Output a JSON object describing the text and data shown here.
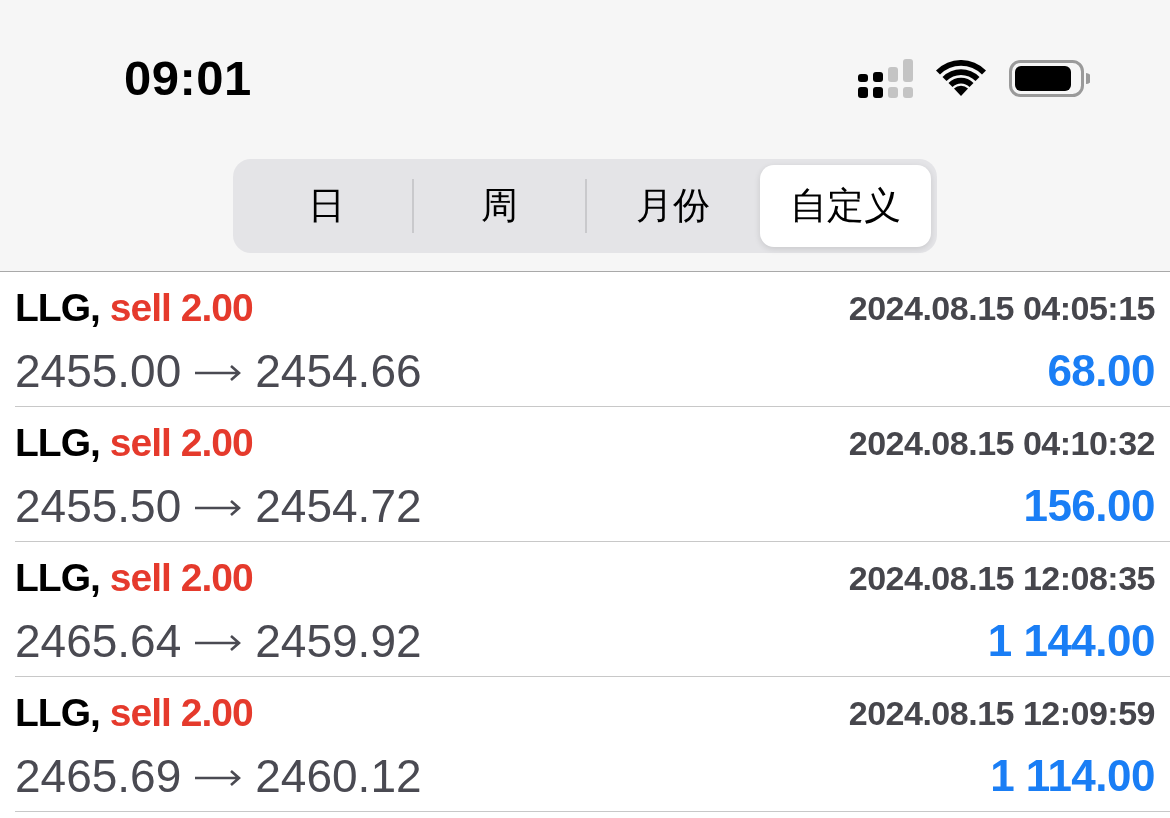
{
  "status_bar": {
    "time": "09:01"
  },
  "period_tabs": [
    {
      "label": "日",
      "selected": false
    },
    {
      "label": "周",
      "selected": false
    },
    {
      "label": "月份",
      "selected": false
    },
    {
      "label": "自定义",
      "selected": true
    }
  ],
  "trades": [
    {
      "symbol": "LLG,",
      "order": "sell 2.00",
      "time": "2024.08.15 04:05:15",
      "open_price": "2455.00",
      "close_price": "2454.66",
      "profit": "68.00"
    },
    {
      "symbol": "LLG,",
      "order": "sell 2.00",
      "time": "2024.08.15 04:10:32",
      "open_price": "2455.50",
      "close_price": "2454.72",
      "profit": "156.00"
    },
    {
      "symbol": "LLG,",
      "order": "sell 2.00",
      "time": "2024.08.15 12:08:35",
      "open_price": "2465.64",
      "close_price": "2459.92",
      "profit": "1 144.00"
    },
    {
      "symbol": "LLG,",
      "order": "sell 2.00",
      "time": "2024.08.15 12:09:59",
      "open_price": "2465.69",
      "close_price": "2460.12",
      "profit": "1 114.00"
    }
  ]
}
